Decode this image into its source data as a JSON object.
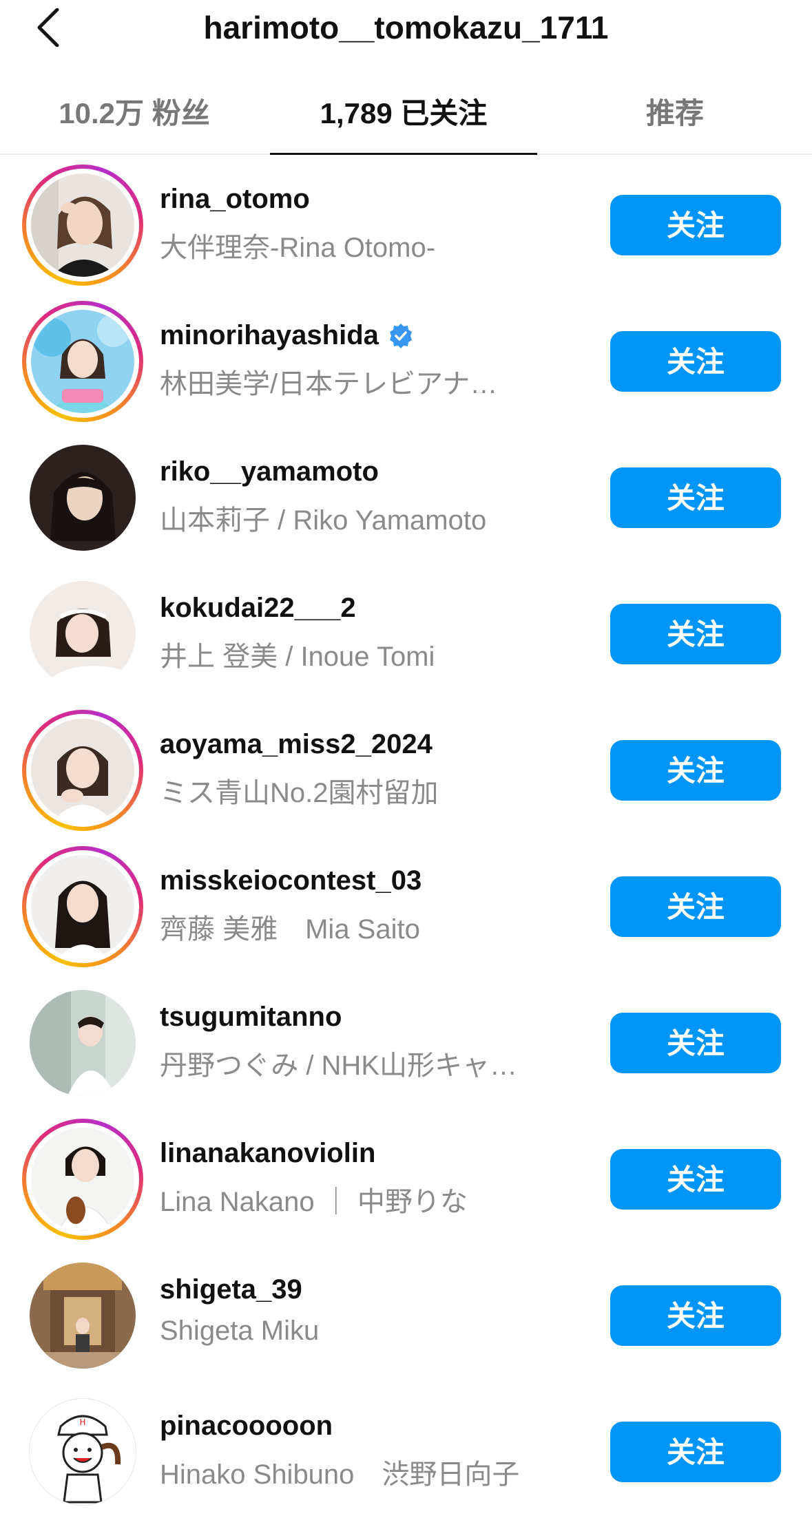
{
  "header": {
    "title": "harimoto__tomokazu_1711",
    "back_icon": "chevron-left-icon"
  },
  "tabs": [
    {
      "label": "10.2万 粉丝",
      "active": false
    },
    {
      "label": "1,789 已关注",
      "active": true
    },
    {
      "label": "推荐",
      "active": false
    }
  ],
  "colors": {
    "accent": "#0095f6",
    "story_ring": [
      "#f9c000",
      "#dd2a7b",
      "#b72fc8"
    ]
  },
  "users": [
    {
      "username": "rina_otomo",
      "fullname": "大伴理奈-Rina Otomo-",
      "button": "关注",
      "story_ring": true,
      "verified": false
    },
    {
      "username": "minorihayashida",
      "fullname": "林田美学/日本テレビアナ…",
      "button": "关注",
      "story_ring": true,
      "verified": true
    },
    {
      "username": "riko__yamamoto",
      "fullname": "山本莉子 / Riko Yamamoto",
      "button": "关注",
      "story_ring": false,
      "verified": false
    },
    {
      "username": "kokudai22___2",
      "fullname": "井上 登美 / Inoue Tomi",
      "button": "关注",
      "story_ring": false,
      "verified": false
    },
    {
      "username": "aoyama_miss2_2024",
      "fullname": "ミス青山No.2園村留加",
      "button": "关注",
      "story_ring": true,
      "verified": false
    },
    {
      "username": "misskeiocontest_03",
      "fullname": "齊藤 美雅　Mia  Saito",
      "button": "关注",
      "story_ring": true,
      "verified": false
    },
    {
      "username": "tsugumitanno",
      "fullname": "丹野つぐみ / NHK山形キャ…",
      "button": "关注",
      "story_ring": false,
      "verified": false
    },
    {
      "username": "linanakanoviolin",
      "fullname": "Lina Nakano ｜ 中野りな",
      "button": "关注",
      "story_ring": true,
      "verified": false
    },
    {
      "username": "shigeta_39",
      "fullname": "Shigeta Miku",
      "button": "关注",
      "story_ring": false,
      "verified": false
    },
    {
      "username": "pinacooooon",
      "fullname": "Hinako  Shibuno　渋野日向子",
      "button": "关注",
      "story_ring": false,
      "verified": false
    }
  ]
}
